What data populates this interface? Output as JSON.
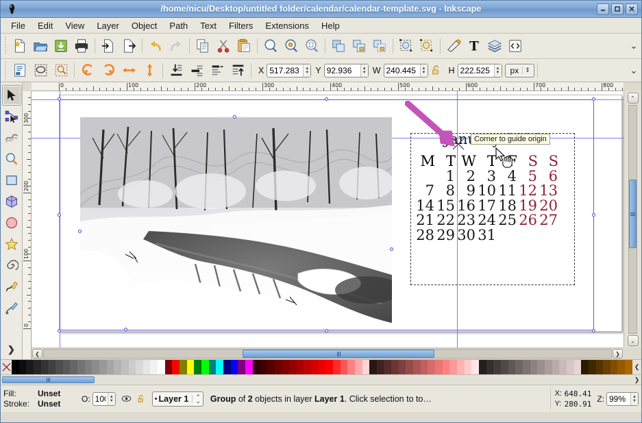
{
  "window": {
    "title": "/home/nicu/Desktop/untitled folder/calendar/calendar-template.svg - Inkscape",
    "minimize_label": "_",
    "maximize_label": "□",
    "close_label": "X"
  },
  "menubar": {
    "items": [
      {
        "label": "File"
      },
      {
        "label": "Edit"
      },
      {
        "label": "View"
      },
      {
        "label": "Layer"
      },
      {
        "label": "Object"
      },
      {
        "label": "Path"
      },
      {
        "label": "Text"
      },
      {
        "label": "Filters"
      },
      {
        "label": "Extensions"
      },
      {
        "label": "Help"
      }
    ]
  },
  "command_toolbar": {
    "buttons": [
      {
        "name": "new-document-icon"
      },
      {
        "name": "open-document-icon"
      },
      {
        "name": "save-document-icon"
      },
      {
        "name": "print-icon"
      },
      {
        "name": "import-icon"
      },
      {
        "name": "export-icon"
      },
      {
        "name": "undo-icon"
      },
      {
        "name": "redo-icon"
      },
      {
        "name": "copy-icon"
      },
      {
        "name": "cut-icon"
      },
      {
        "name": "paste-icon"
      },
      {
        "name": "zoom-selection-icon"
      },
      {
        "name": "zoom-drawing-icon"
      },
      {
        "name": "zoom-page-icon"
      },
      {
        "name": "duplicate-icon"
      },
      {
        "name": "group-icon"
      },
      {
        "name": "ungroup-icon"
      },
      {
        "name": "clone-icon"
      },
      {
        "name": "unclone-icon"
      },
      {
        "name": "fill-and-stroke-icon"
      },
      {
        "name": "text-and-font-icon"
      },
      {
        "name": "layers-icon"
      },
      {
        "name": "xml-editor-icon"
      }
    ],
    "overflow_label": "⌄"
  },
  "tool_options_toolbar": {
    "buttons": [
      {
        "name": "select-all-icon"
      },
      {
        "name": "select-all-in-layers-icon"
      },
      {
        "name": "deselect-icon"
      },
      {
        "name": "rotate-ccw-icon"
      },
      {
        "name": "rotate-cw-icon"
      },
      {
        "name": "flip-horizontal-icon"
      },
      {
        "name": "flip-vertical-icon"
      },
      {
        "name": "lower-to-bottom-icon"
      },
      {
        "name": "lower-icon"
      },
      {
        "name": "raise-icon"
      },
      {
        "name": "raise-to-top-icon"
      }
    ],
    "x_label": "X",
    "x_value": "517.283",
    "y_label": "Y",
    "y_value": "92.936",
    "w_label": "W",
    "w_value": "240.445",
    "h_label": "H",
    "h_value": "222.525",
    "lock_icon": "lock-open-icon",
    "unit": "px",
    "overflow_label": "⌄"
  },
  "toolbox": {
    "tools": [
      {
        "name": "selector-tool",
        "label": "Selector",
        "active": true
      },
      {
        "name": "node-tool",
        "label": "Node editor",
        "active": false
      },
      {
        "name": "tweak-tool",
        "label": "Tweak",
        "active": false
      },
      {
        "name": "zoom-tool",
        "label": "Zoom",
        "active": false
      },
      {
        "name": "rectangle-tool",
        "label": "Rectangle",
        "active": false
      },
      {
        "name": "box3d-tool",
        "label": "3D Box",
        "active": false
      },
      {
        "name": "ellipse-tool",
        "label": "Ellipse",
        "active": false
      },
      {
        "name": "star-tool",
        "label": "Star",
        "active": false
      },
      {
        "name": "spiral-tool",
        "label": "Spiral",
        "active": false
      },
      {
        "name": "pencil-tool",
        "label": "Pencil",
        "active": false
      },
      {
        "name": "calligraphy-tool",
        "label": "Calligraphy",
        "active": false
      }
    ],
    "more_label": "❯"
  },
  "rulers": {
    "horizontal_ticks": [
      "0",
      "100",
      "200",
      "300",
      "400",
      "500",
      "600",
      "700",
      "800"
    ],
    "vertical_ticks": [
      "0",
      "100",
      "200",
      "300"
    ]
  },
  "canvas": {
    "tooltip": "Corner to guide origin",
    "image_alt": "winter-landscape-photo",
    "calendar": {
      "title": "January 2013",
      "weekday_headers": [
        "M",
        "T",
        "W",
        "T",
        "F",
        "S",
        "S"
      ],
      "weeks": [
        [
          "",
          "1",
          "2",
          "3",
          "4",
          "5",
          "6"
        ],
        [
          "7",
          "8",
          "9",
          "10",
          "11",
          "12",
          "13"
        ],
        [
          "14",
          "15",
          "16",
          "17",
          "18",
          "19",
          "20"
        ],
        [
          "21",
          "22",
          "23",
          "24",
          "25",
          "26",
          "27"
        ],
        [
          "28",
          "29",
          "30",
          "31",
          "",
          "",
          ""
        ]
      ],
      "weekend_color": "#8f2233",
      "weekday_color": "#1b1b1b"
    },
    "annotation_arrow_color": "#c455b8"
  },
  "scrollbars": {
    "left_arrow": "❮",
    "right_arrow": "❯",
    "up_arrow": "⌃",
    "down_arrow": "⌄"
  },
  "palette": {
    "none_label": "X",
    "overflow_label": "❮",
    "colors": [
      "#000000",
      "#0d0d0d",
      "#1a1a1a",
      "#262626",
      "#333333",
      "#404040",
      "#4d4d4d",
      "#595959",
      "#666666",
      "#737373",
      "#808080",
      "#8c8c8c",
      "#999999",
      "#a6a6a6",
      "#b3b3b3",
      "#bfbfbf",
      "#cccccc",
      "#d9d9d9",
      "#e6e6e6",
      "#f2f2f2",
      "#ffffff",
      "#800000",
      "#ff0000",
      "#808000",
      "#ffff00",
      "#008000",
      "#00ff00",
      "#008080",
      "#00ffff",
      "#000080",
      "#0000ff",
      "#800080",
      "#ff00ff",
      "#2b0000",
      "#400000",
      "#550000",
      "#6b0000",
      "#800000",
      "#960000",
      "#ab0000",
      "#c00000",
      "#d60000",
      "#eb0000",
      "#ff0000",
      "#ff2b2b",
      "#ff5555",
      "#ff8080",
      "#ffaaaa",
      "#ffd5d5",
      "#2b1616",
      "#402020",
      "#552b2b",
      "#6b3535",
      "#804040",
      "#964b4b",
      "#ab5555",
      "#c06060",
      "#d66b6b",
      "#eb7575",
      "#ff8080",
      "#ff9999",
      "#ffb3b3",
      "#ffcccc",
      "#ffe6e6",
      "#241f1f",
      "#332d2d",
      "#423b3b",
      "#514949",
      "#605757",
      "#6f6565",
      "#7e7373",
      "#8d8181",
      "#9c8f8f",
      "#ab9d9d",
      "#baabab",
      "#c9b9b9",
      "#d8c7c7",
      "#e7d5d5",
      "#2b1a00",
      "#402700",
      "#553300",
      "#6b4000",
      "#804d00",
      "#965900",
      "#ab6600"
    ]
  },
  "statusbar": {
    "fill_label": "Fill:",
    "fill_value": "Unset",
    "stroke_label": "Stroke:",
    "stroke_value": "Unset",
    "opacity_label": "O:",
    "opacity_value": "100",
    "eye_icon": "visibility-icon",
    "lock_icon": "layer-lock-icon",
    "layer_name": "Layer 1",
    "status_message_prefix": "Group",
    "status_message_mid": " of ",
    "status_message_count": "2",
    "status_message_tail": " objects in layer ",
    "status_message_layer": "Layer 1",
    "status_message_end": ". Click selection to toggl..",
    "cursor_x_label": "X:",
    "cursor_x": "648.41",
    "cursor_y_label": "Y:",
    "cursor_y": "280.91",
    "zoom_label": "Z:",
    "zoom_value": "99%"
  }
}
